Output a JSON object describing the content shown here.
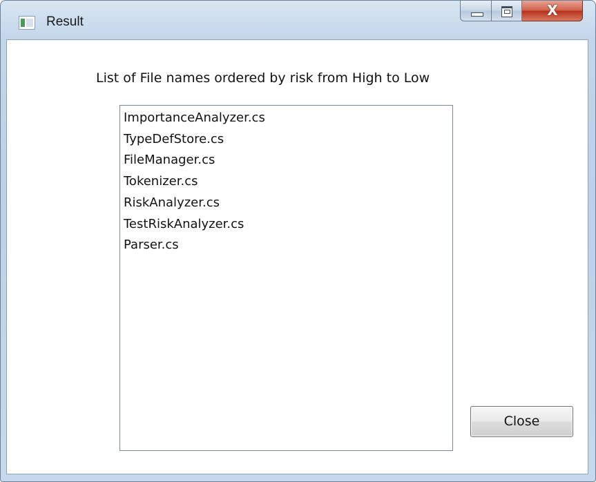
{
  "window": {
    "title": "Result",
    "icon": "application-window-icon",
    "caption_buttons": {
      "minimize": "minimize-icon",
      "maximize": "maximize-icon",
      "close": "close-icon",
      "close_glyph": "X"
    },
    "accent_color": "#c3d6ea",
    "close_button_color": "#c8442c"
  },
  "main": {
    "heading": "List of File names ordered by risk from High to Low",
    "files": [
      "ImportanceAnalyzer.cs",
      "TypeDefStore.cs",
      "FileManager.cs",
      "Tokenizer.cs",
      "RiskAnalyzer.cs",
      "TestRiskAnalyzer.cs",
      "Parser.cs"
    ],
    "close_label": "Close"
  }
}
